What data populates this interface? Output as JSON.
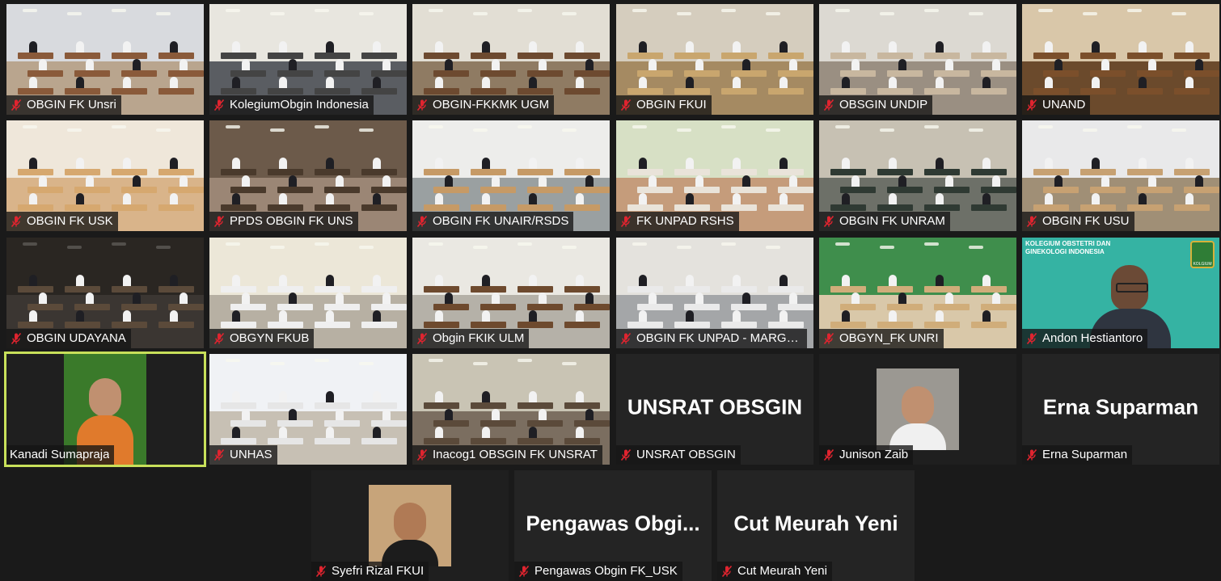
{
  "meeting": {
    "tiles": [
      {
        "label": "OBGIN FK Unsri",
        "muted": true,
        "kind": "room",
        "wall": "#d8dade",
        "floor": "#b9a58e",
        "desk": "#8a5a3a"
      },
      {
        "label": "KolegiumObgin Indonesia",
        "muted": true,
        "kind": "room",
        "wall": "#e8e6df",
        "floor": "#5a5d62",
        "desk": "#444"
      },
      {
        "label": "OBGIN-FKKMK UGM",
        "muted": true,
        "kind": "room",
        "wall": "#e2ded4",
        "floor": "#8f7b63",
        "desk": "#6d4a30"
      },
      {
        "label": "OBGIN FKUI",
        "muted": true,
        "kind": "room",
        "wall": "#d5cdbe",
        "floor": "#a58a62",
        "desk": "#c9a66e"
      },
      {
        "label": "OBSGIN UNDIP",
        "muted": true,
        "kind": "room",
        "wall": "#dcd9d2",
        "floor": "#9a8f82",
        "desk": "#c8b79f"
      },
      {
        "label": "UNAND",
        "muted": true,
        "kind": "room",
        "wall": "#d9c7a9",
        "floor": "#6b4a2c",
        "desk": "#7b4f2b"
      },
      {
        "label": "OBGIN FK USK",
        "muted": true,
        "kind": "room",
        "wall": "#efe7da",
        "floor": "#d9b48a",
        "desk": "#d6a86f"
      },
      {
        "label": "PPDS OBGIN FK UNS",
        "muted": true,
        "kind": "room",
        "wall": "#6c5a4a",
        "floor": "#9b8675",
        "desk": "#4a3a2c"
      },
      {
        "label": "OBGIN FK UNAIR/RSDS",
        "muted": true,
        "kind": "room",
        "wall": "#ededeb",
        "floor": "#9aa0a1",
        "desk": "#c69a66"
      },
      {
        "label": "FK UNPAD RSHS",
        "muted": true,
        "kind": "room",
        "wall": "#d7e0c5",
        "floor": "#c59c7b",
        "desk": "#e9e3d9"
      },
      {
        "label": "OBGIN FK UNRAM",
        "muted": true,
        "kind": "room",
        "wall": "#c7c1b3",
        "floor": "#6d7068",
        "desk": "#2f3a33"
      },
      {
        "label": "OBGIN FK USU",
        "muted": true,
        "kind": "room",
        "wall": "#e9e9ea",
        "floor": "#a08f76",
        "desk": "#c7a172"
      },
      {
        "label": "OBGIN UDAYANA",
        "muted": true,
        "kind": "room",
        "wall": "#2a2622",
        "floor": "#3b3632",
        "desk": "#5b4a3a"
      },
      {
        "label": "OBGYN FKUB",
        "muted": true,
        "kind": "room",
        "wall": "#ece7d8",
        "floor": "#b7b0a3",
        "desk": "#efefef"
      },
      {
        "label": "Obgin FKIK ULM",
        "muted": true,
        "kind": "room",
        "wall": "#eae8e2",
        "floor": "#b5b1a8",
        "desk": "#6e4a2e"
      },
      {
        "label": "OBGIN FK UNPAD - MARGO...",
        "muted": true,
        "kind": "room",
        "wall": "#e4e2dd",
        "floor": "#a4a6a8",
        "desk": "#eaeaea"
      },
      {
        "label": "OBGYN_FK UNRI",
        "muted": true,
        "kind": "room",
        "wall": "#3f8e4c",
        "floor": "#d9c8a9",
        "desk": "#d0ad7a"
      },
      {
        "label": "Andon Hestiantoro",
        "muted": true,
        "kind": "person",
        "bg": "#35b3a3",
        "skin": "#6b4a36",
        "shirt": "#2f3540"
      },
      {
        "label": "Kanadi Sumapraja",
        "muted": false,
        "kind": "person-inset",
        "bg": "#3a7a2a",
        "skin": "#c09070",
        "shirt": "#e07a2c"
      },
      {
        "label": "UNHAS",
        "muted": true,
        "kind": "room",
        "wall": "#f0f2f5",
        "floor": "#c7c0b4",
        "desk": "#e6e6e6"
      },
      {
        "label": "Inacog1 OBSGIN FK UNSRAT",
        "muted": true,
        "kind": "room",
        "wall": "#c9c4b4",
        "floor": "#7b6e60",
        "desk": "#5b4a3a"
      },
      {
        "label": "UNSRAT OBSGIN",
        "muted": true,
        "kind": "avatar",
        "avatar_text": "UNSRAT OBSGIN"
      },
      {
        "label": "Junison Zaib",
        "muted": true,
        "kind": "photo-inset",
        "bg": "#9b9892",
        "skin": "#c09070",
        "shirt": "#f0f0f0"
      },
      {
        "label": "Erna  Suparman",
        "muted": true,
        "kind": "avatar",
        "avatar_text": "Erna  Suparman"
      },
      {
        "label": "Syefri Rizal FKUI",
        "muted": true,
        "kind": "photo-inset",
        "bg": "#c7a47a",
        "skin": "#b07a55",
        "shirt": "#1c1c1c"
      },
      {
        "label": "Pengawas Obgin FK_USK",
        "muted": true,
        "kind": "avatar",
        "avatar_text": "Pengawas  Obgi..."
      },
      {
        "label": "Cut Meurah Yeni",
        "muted": true,
        "kind": "avatar",
        "avatar_text": "Cut Meurah Yeni"
      }
    ]
  },
  "colors": {
    "background": "#1a1a1a",
    "tile": "#242424",
    "active_speaker_border": "#c8e05a",
    "mute_icon": "#e0242f"
  },
  "andon_banner": "KOLEGIUM OBSTETRI DAN GINEKOLOGI INDONESIA",
  "andon_logo_text": "KOLGIUM"
}
